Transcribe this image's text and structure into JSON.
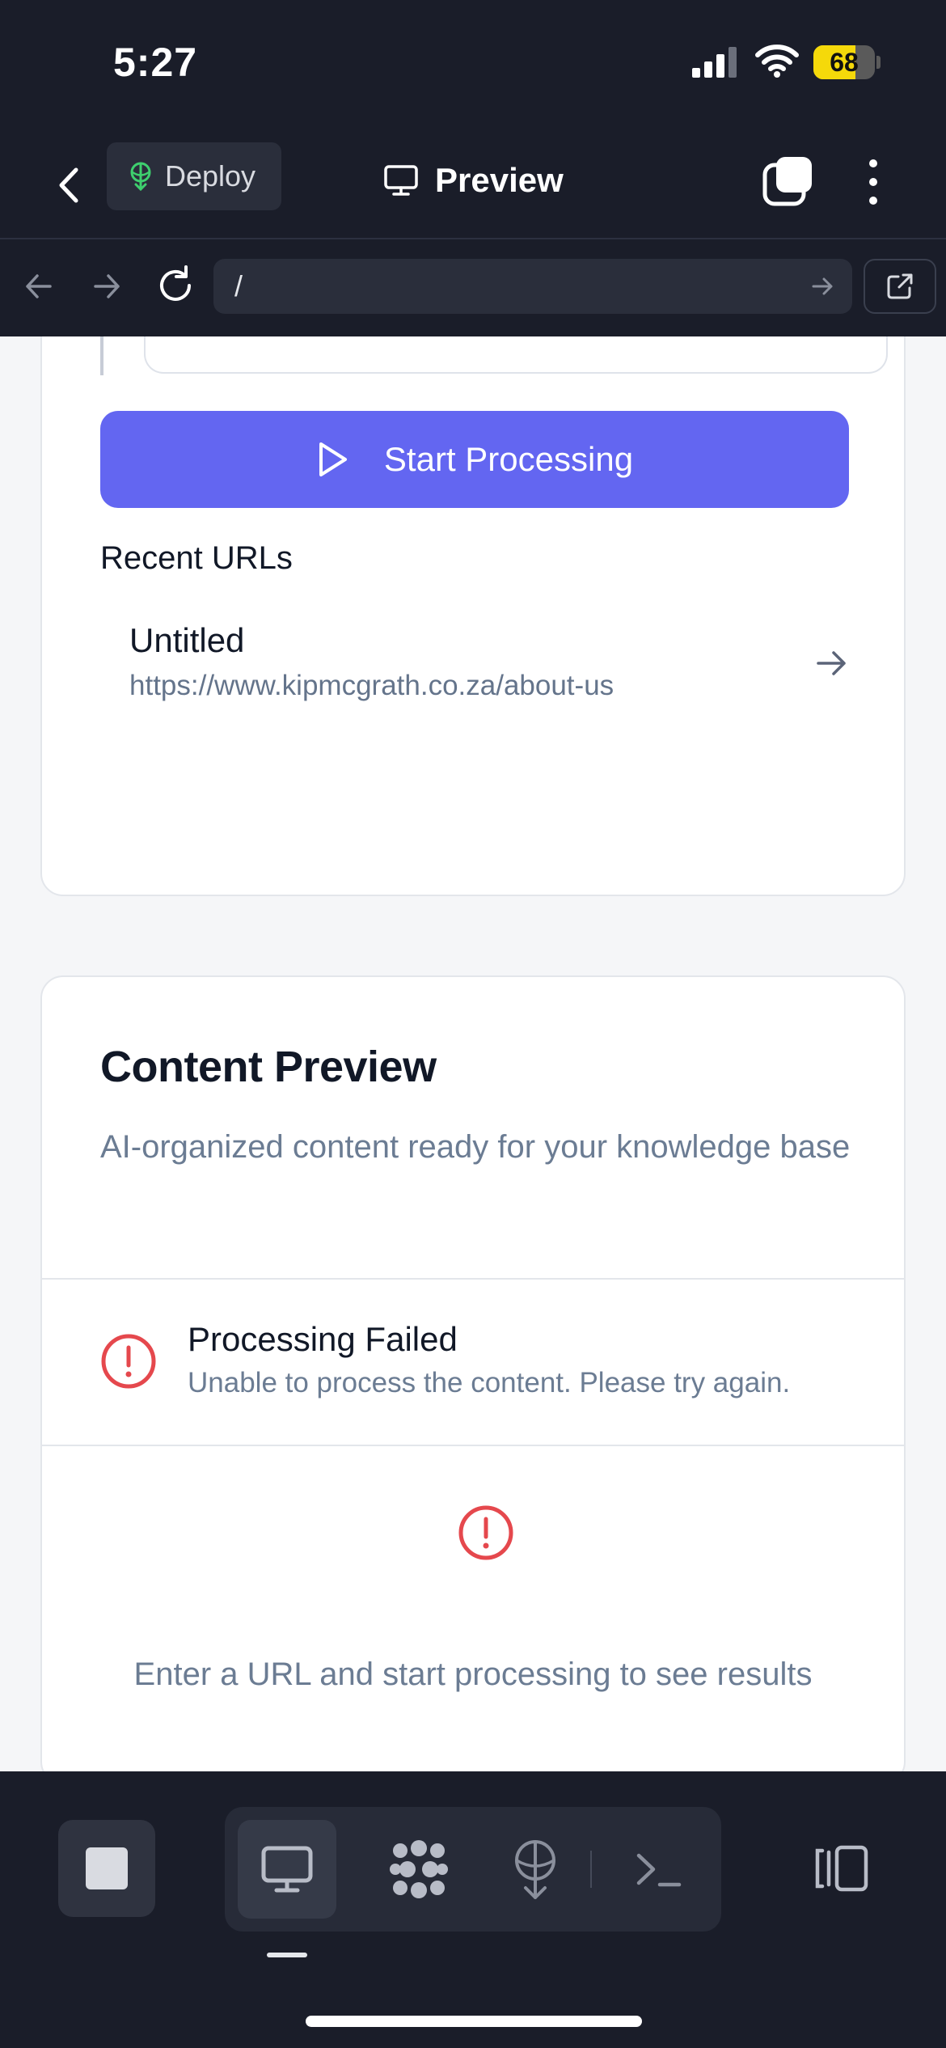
{
  "status_bar": {
    "time": "5:27",
    "battery_percent": "68",
    "battery_level": 0.68
  },
  "nav": {
    "deploy_label": "Deploy",
    "title": "Preview"
  },
  "browser": {
    "url": "/"
  },
  "input_card": {
    "start_button_label": "Start Processing",
    "recent_heading": "Recent URLs",
    "recent_items": [
      {
        "title": "Untitled",
        "url": "https://www.kipmcgrath.co.za/about-us"
      }
    ]
  },
  "preview_card": {
    "heading": "Content Preview",
    "description": "AI-organized content ready for your knowledge base",
    "error": {
      "title": "Processing Failed",
      "message": "Unable to process the content. Please try again."
    },
    "empty_text": "Enter a URL and start processing to see results"
  },
  "colors": {
    "accent": "#6366f1",
    "error": "#e5484d",
    "dark_bg": "#1a1d29",
    "deploy_green": "#3ecf6e"
  },
  "icons": [
    "back-icon",
    "deploy-icon",
    "monitor-icon",
    "tabs-icon",
    "more-icon",
    "arrow-left-icon",
    "arrow-right-icon",
    "reload-icon",
    "open-external-icon",
    "play-icon",
    "alert-circle-icon",
    "stop-icon",
    "apps-icon",
    "terminal-icon",
    "panel-icon"
  ]
}
